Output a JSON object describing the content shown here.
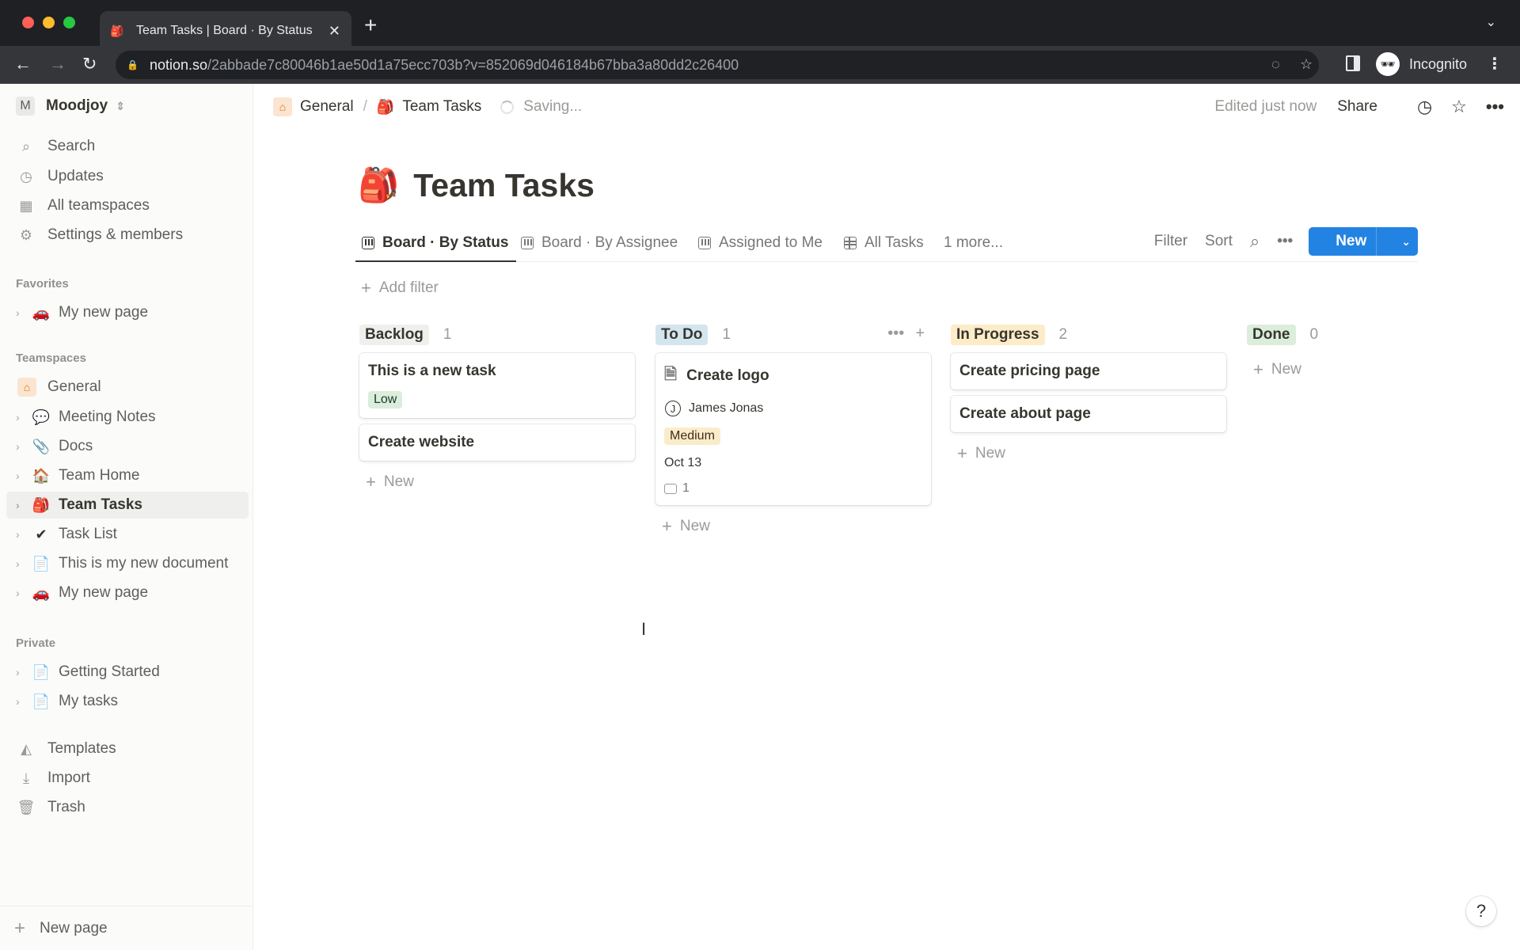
{
  "browser": {
    "tab_title": "Team Tasks | Board · By Status",
    "tab_favicon": "backpack-emoji",
    "url_host": "notion.so",
    "url_path": "/2abbade7c80046b1ae50d1a75ecc703b?v=852069d046184b67bba3a80dd2c26400",
    "profile_label": "Incognito",
    "icons": [
      "back-icon",
      "forward-icon",
      "reload-icon",
      "lock-icon",
      "eye-off-icon",
      "star-icon",
      "side-panel-icon",
      "incognito-icon",
      "kebab-icon"
    ]
  },
  "sidebar": {
    "workspace_initial": "M",
    "workspace_name": "Moodjoy",
    "nav": [
      {
        "label": "Search",
        "icon": "search-icon"
      },
      {
        "label": "Updates",
        "icon": "clock-icon"
      },
      {
        "label": "All teamspaces",
        "icon": "building-icon"
      },
      {
        "label": "Settings & members",
        "icon": "gear-icon"
      }
    ],
    "favorites_heading": "Favorites",
    "favorites": [
      {
        "label": "My new page",
        "emoji": "🚗"
      }
    ],
    "teamspaces_heading": "Teamspaces",
    "teamspace_name": "General",
    "teamspace_pages": [
      {
        "label": "Meeting Notes",
        "emoji": "💬"
      },
      {
        "label": "Docs",
        "emoji": "📎"
      },
      {
        "label": "Team Home",
        "emoji": "🏠"
      },
      {
        "label": "Team Tasks",
        "emoji": "🎒",
        "active": true
      },
      {
        "label": "Task List",
        "emoji": "✔"
      },
      {
        "label": "This is my new document",
        "emoji": "📄"
      },
      {
        "label": "My new page",
        "emoji": "🚗"
      }
    ],
    "private_heading": "Private",
    "private_pages": [
      {
        "label": "Getting Started",
        "emoji": "📄"
      },
      {
        "label": "My tasks",
        "emoji": "📄"
      }
    ],
    "utilities": [
      {
        "label": "Templates",
        "icon": "templates-icon"
      },
      {
        "label": "Import",
        "icon": "import-icon"
      },
      {
        "label": "Trash",
        "icon": "trash-icon"
      }
    ],
    "new_page_label": "New page"
  },
  "topbar": {
    "breadcrumb": [
      {
        "label": "General",
        "emoji": "🏠"
      },
      {
        "label": "Team Tasks",
        "emoji": "🎒"
      }
    ],
    "separator": "/",
    "status": "Saving...",
    "edited": "Edited just now",
    "share_label": "Share"
  },
  "page": {
    "emoji": "🎒",
    "title": "Team Tasks",
    "views": [
      {
        "label": "Board · By Status",
        "type": "board",
        "active": true
      },
      {
        "label": "Board · By Assignee",
        "type": "board"
      },
      {
        "label": "Assigned to Me",
        "type": "board"
      },
      {
        "label": "All Tasks",
        "type": "table"
      }
    ],
    "more_views": "1 more...",
    "filter_label": "Filter",
    "sort_label": "Sort",
    "new_label": "New",
    "add_filter_label": "Add filter"
  },
  "board": {
    "add_new_label": "New",
    "columns": [
      {
        "name": "Backlog",
        "count": "1",
        "chip_color": "#efefed",
        "cards": [
          {
            "title": "This is a new task",
            "priority": "Low",
            "priority_bg": "#dbeddb"
          },
          {
            "title": "Create website"
          }
        ]
      },
      {
        "name": "To Do",
        "count": "1",
        "chip_color": "#d3e5ef",
        "cards": [
          {
            "title": "Create logo",
            "assignee_initial": "J",
            "assignee": "James Jonas",
            "priority": "Medium",
            "priority_bg": "#fbecc9",
            "date": "Oct 13",
            "comments": "1"
          }
        ]
      },
      {
        "name": "In Progress",
        "count": "2",
        "chip_color": "#fdecc8",
        "cards": [
          {
            "title": "Create pricing page"
          },
          {
            "title": "Create about page"
          }
        ]
      },
      {
        "name": "Done",
        "count": "0",
        "chip_color": "#dbeddb",
        "cards": []
      }
    ]
  },
  "help_label": "?"
}
